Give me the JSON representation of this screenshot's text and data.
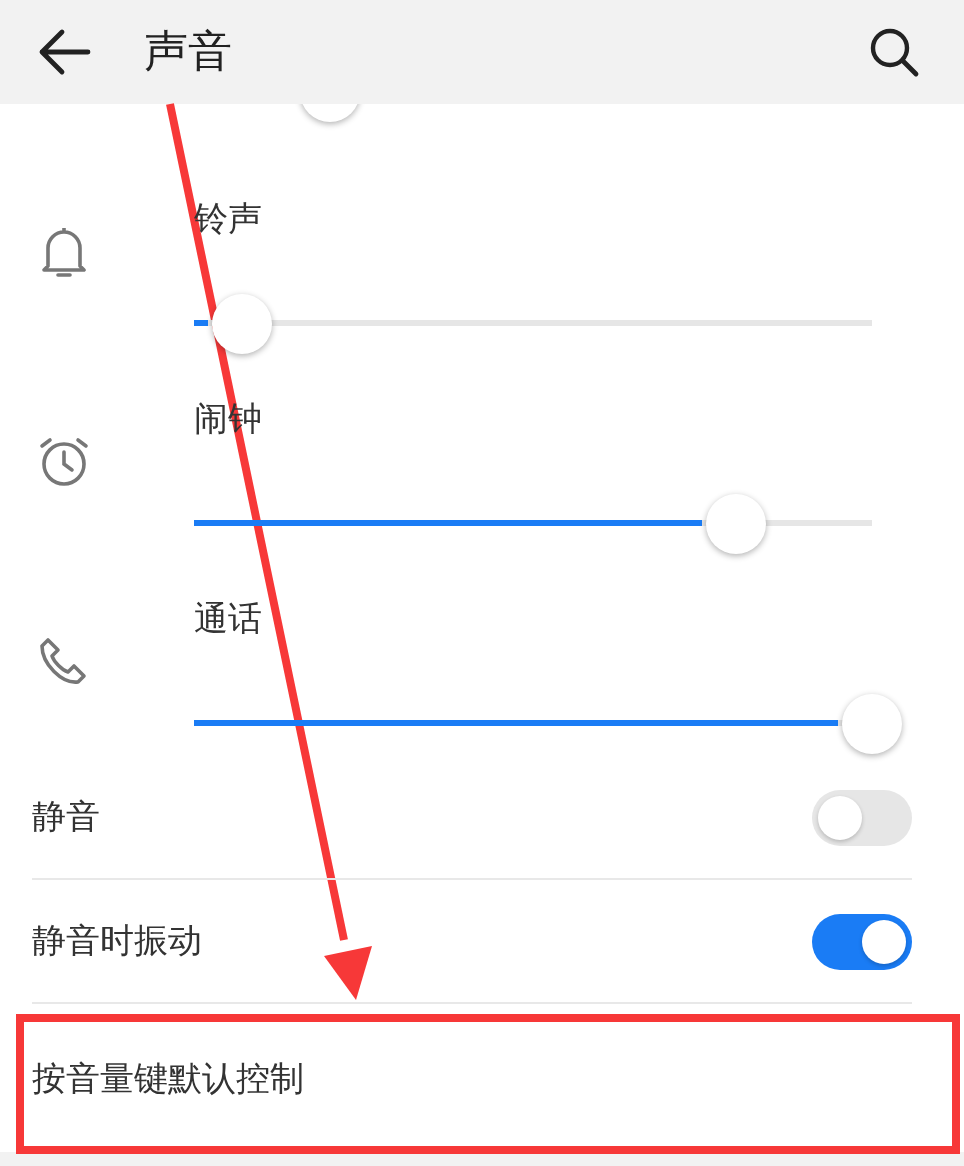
{
  "header": {
    "title": "声音"
  },
  "volume_sliders": [
    {
      "kind": "bell",
      "label": "铃声",
      "level": 0.07
    },
    {
      "kind": "alarm",
      "label": "闹钟",
      "level": 0.8
    },
    {
      "kind": "phone",
      "label": "通话",
      "level": 1.0
    }
  ],
  "toggles": [
    {
      "label": "静音",
      "on": false
    },
    {
      "label": "静音时振动",
      "on": true
    }
  ],
  "settings_rows": [
    {
      "label": "按音量键默认控制"
    }
  ]
}
